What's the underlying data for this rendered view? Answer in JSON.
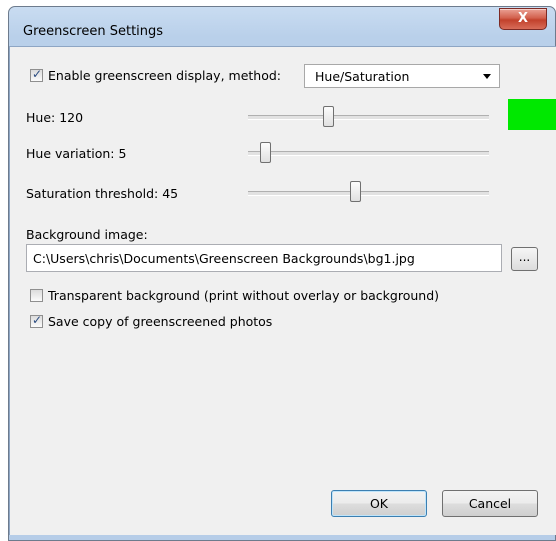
{
  "window": {
    "title": "Greenscreen Settings",
    "close_glyph": "X"
  },
  "enable": {
    "label": "Enable greenscreen display, method:",
    "checked": true
  },
  "method": {
    "selected": "Hue/Saturation"
  },
  "hue": {
    "label": "Hue: 120",
    "value": 120,
    "swatch_color": "#00e800"
  },
  "hue_variation": {
    "label": "Hue variation: 5",
    "value": 5
  },
  "saturation": {
    "label": "Saturation threshold: 45",
    "value": 45
  },
  "background": {
    "label": "Background image:",
    "path": "C:\\Users\\chris\\Documents\\Greenscreen Backgrounds\\bg1.jpg",
    "browse_label": "..."
  },
  "transparent": {
    "label": "Transparent background (print without overlay or background)",
    "checked": false
  },
  "save_copy": {
    "label": "Save copy of greenscreened photos",
    "checked": true
  },
  "buttons": {
    "ok": "OK",
    "cancel": "Cancel"
  },
  "check_glyph": "✓"
}
